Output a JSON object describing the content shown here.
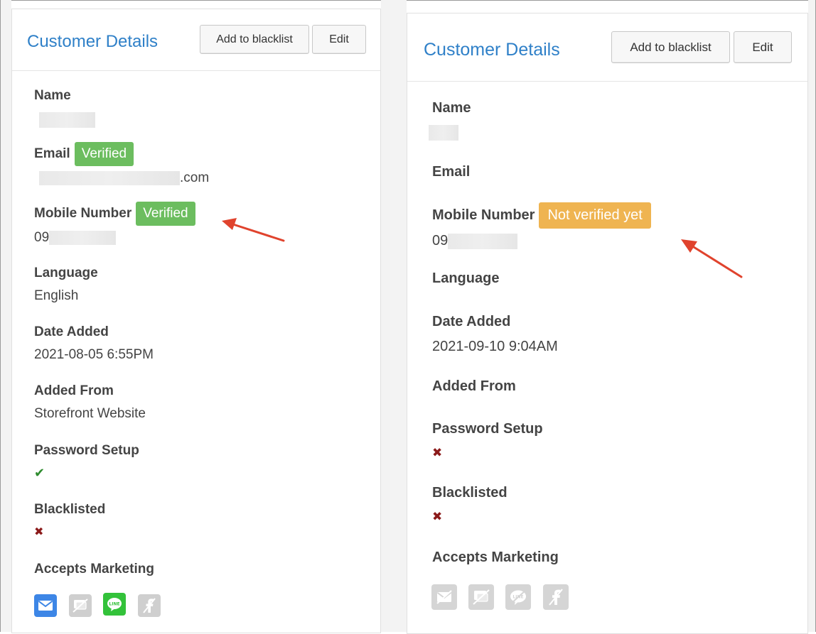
{
  "left_panel": {
    "title": "Customer Details",
    "blacklist_button": "Add to blacklist",
    "edit_button": "Edit",
    "name_label": "Name",
    "email_label": "Email",
    "email_badge": "Verified",
    "email_value_suffix": ".com",
    "mobile_label": "Mobile Number",
    "mobile_badge": "Verified",
    "mobile_prefix": "09",
    "language_label": "Language",
    "language_value": "English",
    "date_label": "Date Added",
    "date_value": "2021-08-05 6:55PM",
    "added_from_label": "Added From",
    "added_from_value": "Storefront Website",
    "password_label": "Password Setup",
    "password_mark": "✔",
    "blacklisted_label": "Blacklisted",
    "blacklisted_mark": "✖",
    "marketing_label": "Accepts Marketing"
  },
  "right_panel": {
    "title": "Customer Details",
    "blacklist_button": "Add to blacklist",
    "edit_button": "Edit",
    "name_label": "Name",
    "email_label": "Email",
    "mobile_label": "Mobile Number",
    "mobile_badge": "Not verified yet",
    "mobile_prefix": "09",
    "language_label": "Language",
    "date_label": "Date Added",
    "date_value": "2021-09-10 9:04AM",
    "added_from_label": "Added From",
    "password_label": "Password Setup",
    "password_mark": "✖",
    "blacklisted_label": "Blacklisted",
    "blacklisted_mark": "✖",
    "marketing_label": "Accepts Marketing"
  },
  "colors": {
    "title_blue": "#2f80c8",
    "verified_green": "#6cbd5f",
    "not_verified_orange": "#efb451",
    "arrow_red": "#e0432d",
    "email_icon_blue": "#3d86e6",
    "line_icon_green": "#33c23a",
    "disabled_gray": "#cfcfcf"
  },
  "icons": {
    "email": "envelope-icon",
    "sms": "sms-chat-icon",
    "line": "line-app-icon",
    "facebook": "facebook-icon"
  }
}
